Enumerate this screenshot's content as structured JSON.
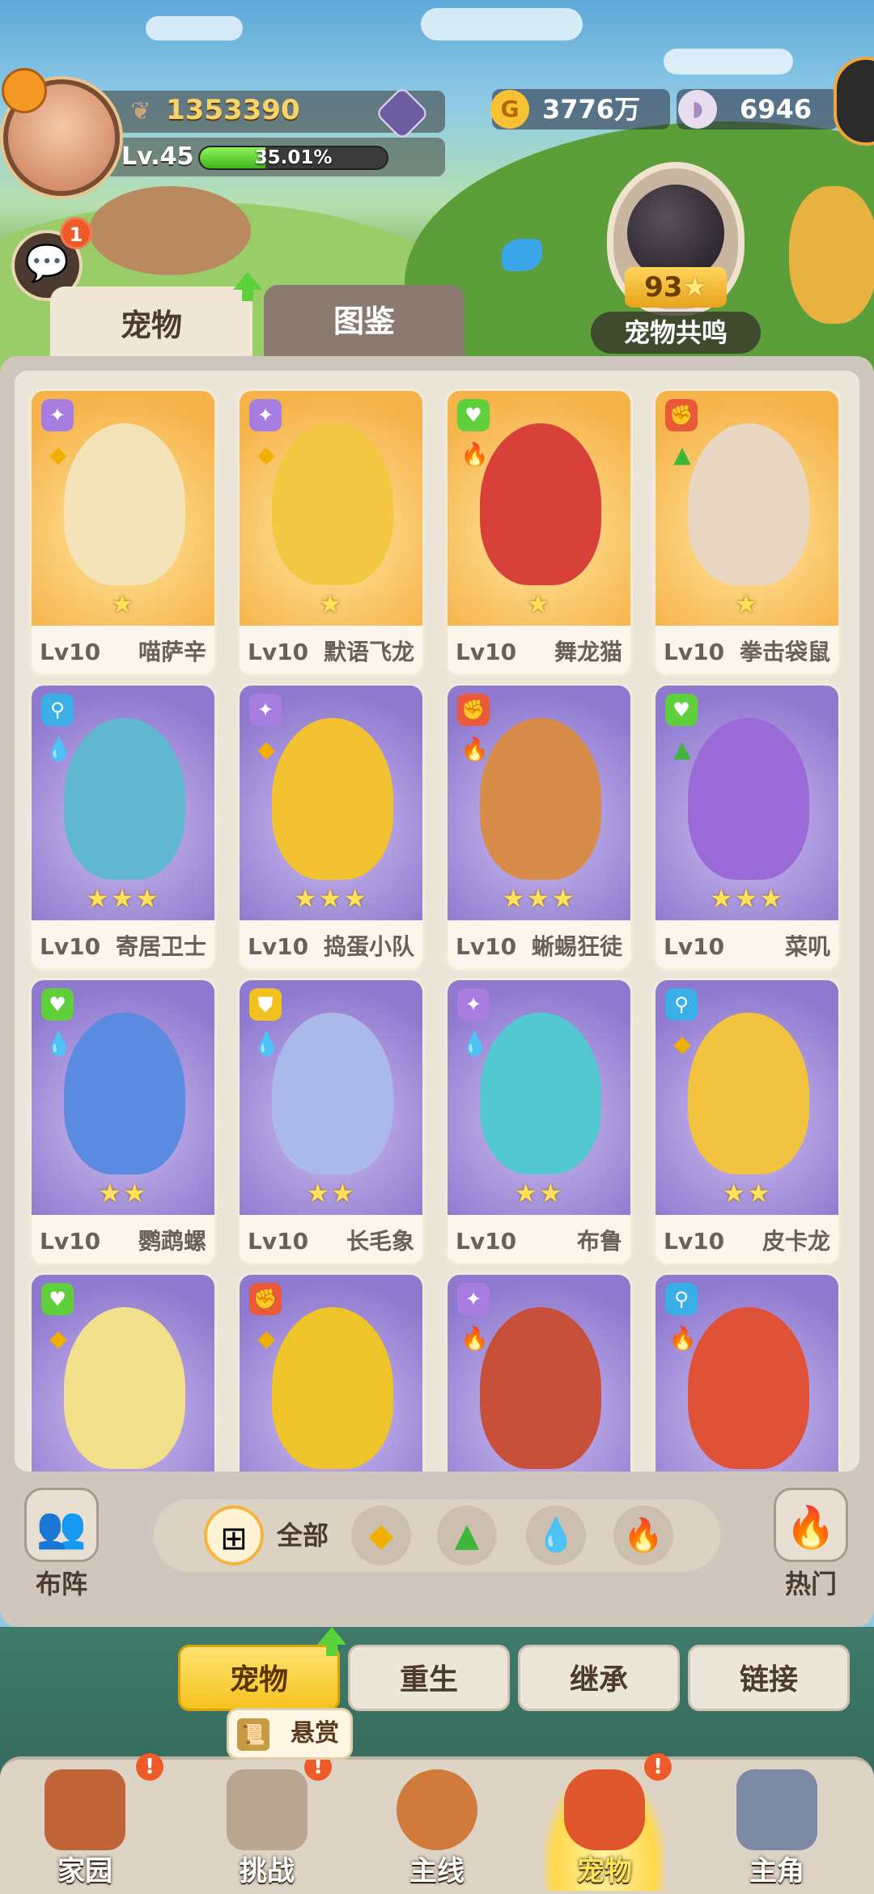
{
  "player": {
    "power": "1353390",
    "level": "Lv.45",
    "xp_percent_text": "35.01%",
    "xp_fraction": 0.3501
  },
  "resources": {
    "gold": "3776万",
    "shells": "6946"
  },
  "chat": {
    "badge": "1"
  },
  "resonance": {
    "value": "93",
    "label": "宠物共鸣"
  },
  "top_tabs": {
    "pets": "宠物",
    "dex": "图鉴"
  },
  "pets": [
    {
      "level": "Lv10",
      "name": "喵萨辛",
      "stars": 1,
      "rarity": "gold",
      "role": "purple",
      "element": "earth"
    },
    {
      "level": "Lv10",
      "name": "默语飞龙",
      "stars": 1,
      "rarity": "gold",
      "role": "purple",
      "element": "earth"
    },
    {
      "level": "Lv10",
      "name": "舞龙猫",
      "stars": 1,
      "rarity": "gold",
      "role": "green",
      "element": "fire"
    },
    {
      "level": "Lv10",
      "name": "拳击袋鼠",
      "stars": 1,
      "rarity": "gold",
      "role": "red",
      "element": "grass"
    },
    {
      "level": "Lv10",
      "name": "寄居卫士",
      "stars": 3,
      "rarity": "purple",
      "role": "blue",
      "element": "water"
    },
    {
      "level": "Lv10",
      "name": "捣蛋小队",
      "stars": 3,
      "rarity": "purple",
      "role": "purple",
      "element": "earth"
    },
    {
      "level": "Lv10",
      "name": "蜥蜴狂徒",
      "stars": 3,
      "rarity": "purple",
      "role": "red",
      "element": "fire"
    },
    {
      "level": "Lv10",
      "name": "菜叽",
      "stars": 3,
      "rarity": "purple",
      "role": "green",
      "element": "grass"
    },
    {
      "level": "Lv10",
      "name": "鹦鹉螺",
      "stars": 2,
      "rarity": "purple",
      "role": "green",
      "element": "water"
    },
    {
      "level": "Lv10",
      "name": "长毛象",
      "stars": 2,
      "rarity": "purple",
      "role": "gold",
      "element": "water"
    },
    {
      "level": "Lv10",
      "name": "布鲁",
      "stars": 2,
      "rarity": "purple",
      "role": "purple",
      "element": "water"
    },
    {
      "level": "Lv10",
      "name": "皮卡龙",
      "stars": 2,
      "rarity": "purple",
      "role": "blue",
      "element": "earth"
    },
    {
      "level": "",
      "name": "",
      "stars": 0,
      "rarity": "purple",
      "role": "green",
      "element": "earth"
    },
    {
      "level": "",
      "name": "",
      "stars": 0,
      "rarity": "purple",
      "role": "red",
      "element": "earth"
    },
    {
      "level": "",
      "name": "",
      "stars": 0,
      "rarity": "purple",
      "role": "purple",
      "element": "fire"
    },
    {
      "level": "",
      "name": "",
      "stars": 0,
      "rarity": "purple",
      "role": "blue",
      "element": "fire"
    }
  ],
  "filters": {
    "formation": "布阵",
    "all": "全部",
    "hot": "热门"
  },
  "sub_tabs": [
    "宠物",
    "重生",
    "继承",
    "链接"
  ],
  "bounty": "悬赏",
  "bottom_nav": [
    "家园",
    "挑战",
    "主线",
    "宠物",
    "主角"
  ],
  "colors": {
    "gold_card": "#f6b34a",
    "purple_card": "#8f79cf",
    "active_tab": "#f5c21e",
    "badge": "#ef5a29"
  }
}
